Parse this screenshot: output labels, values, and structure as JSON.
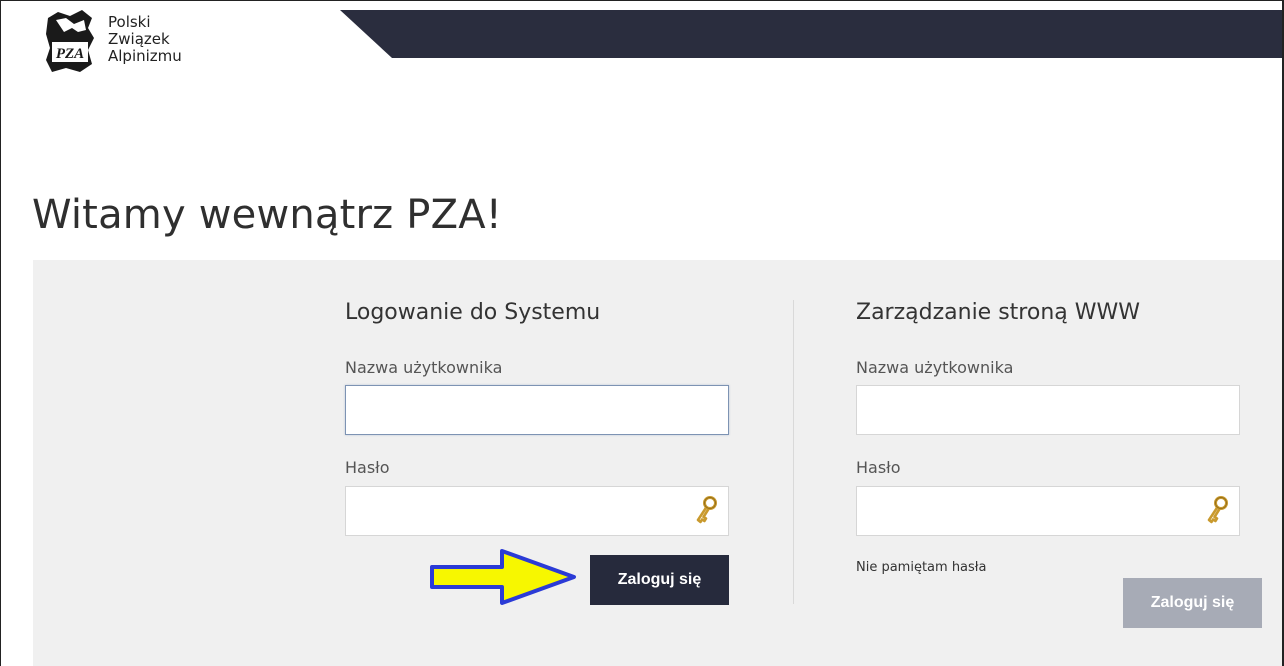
{
  "header": {
    "logo_lines": [
      "Polski",
      "Związek",
      "Alpinizmu"
    ],
    "logo_mark_text": "PZA",
    "bar_color": "#2a2d3e"
  },
  "page": {
    "title": "Witamy wewnątrz PZA!"
  },
  "system_login": {
    "title": "Logowanie do Systemu",
    "username_label": "Nazwa użytkownika",
    "username_value": "",
    "password_label": "Hasło",
    "password_value": "",
    "password_icon": "key-icon",
    "submit_label": "Zaloguj się",
    "submit_color": "#262a3c"
  },
  "www_login": {
    "title": "Zarządzanie stroną WWW",
    "username_label": "Nazwa użytkownika",
    "username_value": "",
    "password_label": "Hasło",
    "password_value": "",
    "password_icon": "key-icon",
    "forgot_link": "Nie pamiętam hasła",
    "submit_label": "Zaloguj się",
    "submit_color": "#a7abb6"
  },
  "annotation": {
    "arrow_icon": "arrow-right-icon",
    "arrow_fill": "#f7f700",
    "arrow_stroke": "#2b3bd6"
  }
}
